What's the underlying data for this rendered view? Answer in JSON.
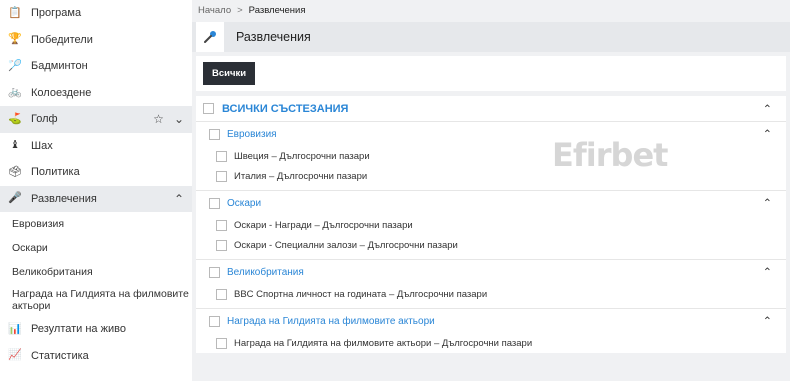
{
  "sidebar": {
    "items": [
      {
        "label": "Програма",
        "icon": "clipboard-icon",
        "glyph": "📋"
      },
      {
        "label": "Победители",
        "icon": "trophy-icon",
        "glyph": "🏆"
      },
      {
        "label": "Бадминтон",
        "icon": "shuttlecock-icon",
        "glyph": "🏸"
      },
      {
        "label": "Колоездене",
        "icon": "bicycle-icon",
        "glyph": "🚲"
      },
      {
        "label": "Голф",
        "icon": "golf-icon",
        "glyph": "⛳"
      },
      {
        "label": "Шах",
        "icon": "chess-icon",
        "glyph": "♝"
      },
      {
        "label": "Политика",
        "icon": "podium-icon",
        "glyph": "🗳"
      },
      {
        "label": "Развлечения",
        "icon": "microphone-icon",
        "glyph": "🎤"
      }
    ],
    "sub_items": [
      "Евровизия",
      "Оскари",
      "Великобритания",
      "Награда на Гилдията на филмовите актьори"
    ],
    "bottom_items": [
      {
        "label": "Резултати на живо",
        "icon": "live-scores-icon",
        "glyph": "📊"
      },
      {
        "label": "Статистика",
        "icon": "statistics-icon",
        "glyph": "📈"
      }
    ]
  },
  "breadcrumb": {
    "home": "Начало",
    "separator": ">",
    "current": "Развлечения"
  },
  "header": {
    "title": "Развлечения",
    "icon": "microphone-icon"
  },
  "filter": {
    "all_button": "Всички"
  },
  "competitions": {
    "all_label": "ВСИЧКИ СЪСТЕЗАНИЯ",
    "groups": [
      {
        "name": "Евровизия",
        "items": [
          "Швеция – Дългосрочни пазари",
          "Италия – Дългосрочни пазари"
        ]
      },
      {
        "name": "Оскари",
        "items": [
          "Оскари - Награди – Дългосрочни пазари",
          "Оскари - Специални залози – Дългосрочни пазари"
        ]
      },
      {
        "name": "Великобритания",
        "items": [
          "BBC Спортна личност на годината – Дългосрочни пазари"
        ]
      },
      {
        "name": "Награда на Гилдията на филмовите актьори",
        "items": [
          "Награда на Гилдията на филмовите актьори – Дългосрочни пазари"
        ]
      }
    ]
  },
  "watermark": "Efirbet",
  "colors": {
    "accent": "#2a86d6",
    "dark_button": "#2b2f36",
    "active_bg": "#e9ebee"
  }
}
